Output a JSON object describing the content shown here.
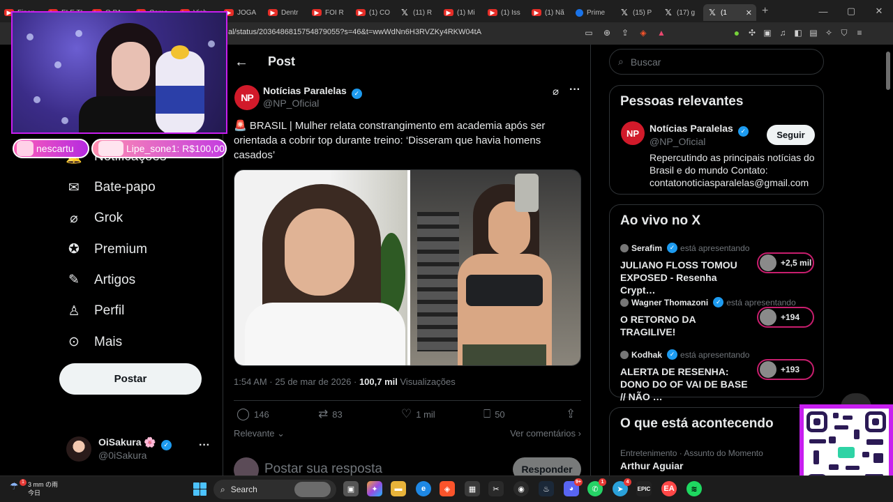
{
  "browser": {
    "tabs": [
      {
        "label": "Finan",
        "kind": "yt"
      },
      {
        "label": "ELE TI",
        "kind": "yt"
      },
      {
        "label": "O PA",
        "kind": "yt"
      },
      {
        "label": "Come",
        "kind": "yt"
      },
      {
        "label": "Vinh",
        "kind": "yt"
      },
      {
        "label": "JOGA",
        "kind": "yt"
      },
      {
        "label": "Dentr",
        "kind": "yt"
      },
      {
        "label": "FOI R",
        "kind": "yt"
      },
      {
        "label": "(1) CO",
        "kind": "yt"
      },
      {
        "label": "(11) R",
        "kind": "x"
      },
      {
        "label": "(1) Mi",
        "kind": "yt"
      },
      {
        "label": "(1) Iss",
        "kind": "yt"
      },
      {
        "label": "(1) Nã",
        "kind": "yt"
      },
      {
        "label": "Prime",
        "kind": "prime"
      },
      {
        "label": "(15) P",
        "kind": "x"
      },
      {
        "label": "(17) g",
        "kind": "x"
      }
    ],
    "active_tab": {
      "label": "(1",
      "close": "✕"
    },
    "new_tab": "+",
    "window_controls": [
      "—",
      "▢",
      "✕"
    ],
    "url": "al/status/2036486815754879055?s=46&t=wwWdNn6H3RVZKy4RKW04tA"
  },
  "nav": {
    "items": [
      {
        "id": "messages",
        "label": "Bate-papo",
        "icon": "mail-icon",
        "glyph": "✉"
      },
      {
        "id": "grok",
        "label": "Grok",
        "icon": "grok-icon",
        "glyph": "⌀"
      },
      {
        "id": "premium",
        "label": "Premium",
        "icon": "premium-icon",
        "glyph": "✪"
      },
      {
        "id": "articles",
        "label": "Artigos",
        "icon": "article-icon",
        "glyph": "✎"
      },
      {
        "id": "profile",
        "label": "Perfil",
        "icon": "person-icon",
        "glyph": "♙"
      },
      {
        "id": "more",
        "label": "Mais",
        "icon": "more-circle-icon",
        "glyph": "⊙"
      }
    ],
    "partial_item": "Notificações",
    "post_button": "Postar",
    "account": {
      "name": "OiSakura",
      "flower": "🌸",
      "handle": "@0iSakura",
      "more": "···"
    }
  },
  "post": {
    "header_title": "Post",
    "back": "←",
    "author": {
      "avatar_text": "NP",
      "name": "Notícias Paralelas",
      "handle": "@NP_Oficial"
    },
    "text_prefix": "🚨",
    "text": " BRASIL | Mulher relata constrangimento em academia após ser orientada a cobrir top durante treino: ‘Disseram que havia homens casados’",
    "time": "1:54 AM · 25 de mar de 2026 · ",
    "views": "100,7 mil",
    "views_label": " Visualizações",
    "actions": {
      "replies": "146",
      "reposts": "83",
      "likes": "1 mil",
      "bookmarks": "50"
    },
    "sort_label": "Relevante",
    "see_replies": "Ver comentários",
    "reply_placeholder": "Postar sua resposta",
    "reply_button": "Responder"
  },
  "sidebar": {
    "search_placeholder": "Buscar",
    "relevant": {
      "title": "Pessoas relevantes",
      "avatar_text": "NP",
      "name": "Notícias Paralelas",
      "handle": "@NP_Oficial",
      "follow": "Seguir",
      "bio": "Repercutindo as principais notícias do Brasil e do mundo Contato: contatonoticiasparalelas@gmail.com"
    },
    "live": {
      "title": "Ao vivo no X",
      "items": [
        {
          "host": "Serafim",
          "status": "está apresentando",
          "title": "JULIANO FLOSS TOMOU EXPOSED - Resenha Crypt…",
          "count": "+2,5 mil"
        },
        {
          "host": "Wagner Thomazoni",
          "status": "está apresentando",
          "title": "O RETORNO DA TRAGILIVE!",
          "count": "+194"
        },
        {
          "host": "Kodhak",
          "status": "está apresentando",
          "title": "ALERTA DE RESENHA: DONO DO OF VAI DE BASE // NÃO …",
          "count": "+193"
        }
      ]
    },
    "trends": {
      "title": "O que está acontecendo",
      "items": [
        {
          "category": "Entretenimento · Assunto do Momento",
          "name": "Arthur Aguiar"
        }
      ]
    }
  },
  "overlay": {
    "alerts": [
      {
        "text": "nescartu"
      },
      {
        "text": "Lipe_sone1: R$100,00"
      }
    ]
  },
  "taskbar": {
    "weather_temp": "3 mm の雨",
    "weather_day": "今日",
    "weather_badge": "1",
    "search_label": "Search",
    "discord_badge": "9+",
    "whatsapp_badge": "1",
    "telegram_badge": "4"
  }
}
